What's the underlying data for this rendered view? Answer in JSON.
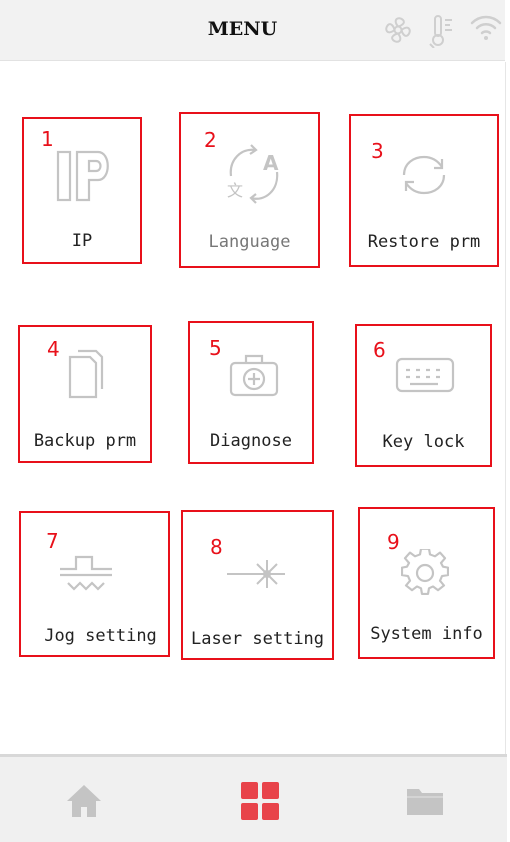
{
  "header": {
    "title": "MENU",
    "status_icons": [
      "fan-icon",
      "temperature-icon",
      "wifi-icon"
    ]
  },
  "tiles": [
    {
      "number": "1",
      "label": "IP",
      "icon": "ip-icon"
    },
    {
      "number": "2",
      "label": "Language",
      "icon": "language-icon"
    },
    {
      "number": "3",
      "label": "Restore prm",
      "icon": "restore-icon"
    },
    {
      "number": "4",
      "label": "Backup prm",
      "icon": "backup-icon"
    },
    {
      "number": "5",
      "label": "Diagnose",
      "icon": "diagnose-icon"
    },
    {
      "number": "6",
      "label": "Key lock",
      "icon": "keyboard-icon"
    },
    {
      "number": "7",
      "label": "Jog setting",
      "icon": "jog-icon"
    },
    {
      "number": "8",
      "label": "Laser setting",
      "icon": "laser-icon"
    },
    {
      "number": "9",
      "label": "System info",
      "icon": "gear-icon"
    }
  ],
  "bottom_nav": {
    "items": [
      "home-icon",
      "menu-grid-icon",
      "folder-icon"
    ],
    "active": "menu-grid-icon"
  },
  "colors": {
    "highlight_border": "#e8101a",
    "active_nav": "#e8434a",
    "icon_grey": "#c4c4c4"
  }
}
